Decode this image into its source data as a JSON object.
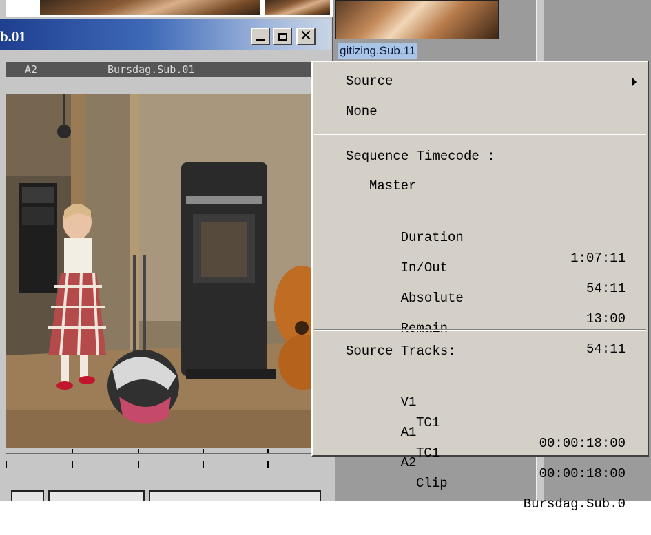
{
  "window": {
    "title": "b.01",
    "close_glyph": "✕"
  },
  "track_bar": {
    "track": "A2",
    "clip": "Bursdag.Sub.01"
  },
  "bin": {
    "selected_clip_label": "gitizing.Sub.11"
  },
  "menu": {
    "source": "Source",
    "none": "None",
    "sequence_timecode_header": "Sequence Timecode :",
    "master": "Master",
    "timecodes": [
      {
        "label": "Duration",
        "value": "1:07:11"
      },
      {
        "label": "In/Out",
        "value": "54:11"
      },
      {
        "label": "Absolute",
        "value": "13:00"
      },
      {
        "label": "Remain",
        "value": "54:11"
      }
    ],
    "source_tracks_header": "Source Tracks:",
    "source_tracks": [
      {
        "track": "V1",
        "tc": "TC1",
        "value": "00:00:18:00"
      },
      {
        "track": "A1",
        "tc": "TC1",
        "value": "00:00:18:00"
      },
      {
        "track": "A2",
        "tc": "Clip",
        "value": "Bursdag.Sub.0"
      }
    ]
  },
  "icons": [
    "minimize-icon",
    "maximize-icon",
    "close-icon",
    "submenu-arrow-icon"
  ],
  "colors": {
    "titlebar_start": "#1f3f8f",
    "titlebar_end": "#c8d4e6",
    "menu_bg": "#d4d0c8",
    "selection": "#a9c4e6"
  }
}
